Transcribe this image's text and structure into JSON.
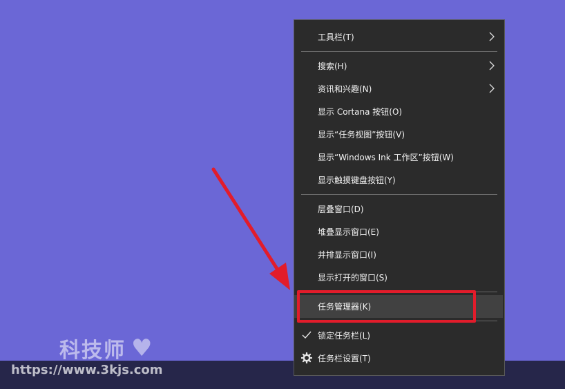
{
  "menu": {
    "items": [
      {
        "label": "工具栏(T)",
        "submenu": true
      },
      {
        "label": "搜索(H)",
        "submenu": true
      },
      {
        "label": "资讯和兴趣(N)",
        "submenu": true
      },
      {
        "label": "显示 Cortana 按钮(O)"
      },
      {
        "label": "显示“任务视图”按钮(V)"
      },
      {
        "label": "显示“Windows Ink 工作区”按钮(W)"
      },
      {
        "label": "显示触摸键盘按钮(Y)"
      },
      {
        "label": "层叠窗口(D)"
      },
      {
        "label": "堆叠显示窗口(E)"
      },
      {
        "label": "并排显示窗口(I)"
      },
      {
        "label": "显示打开的窗口(S)"
      },
      {
        "label": "任务管理器(K)",
        "highlighted": true
      },
      {
        "label": "锁定任务栏(L)",
        "icon": "checkmark-icon"
      },
      {
        "label": "任务栏设置(T)",
        "icon": "gear-icon"
      }
    ]
  },
  "watermark": {
    "text": "科技师",
    "url": "https://www.3kjs.com"
  },
  "colors": {
    "desktop": "#6b67d6",
    "menu_bg": "#2b2b2b",
    "highlight": "#414141",
    "annotation_red": "#e21c2b"
  }
}
